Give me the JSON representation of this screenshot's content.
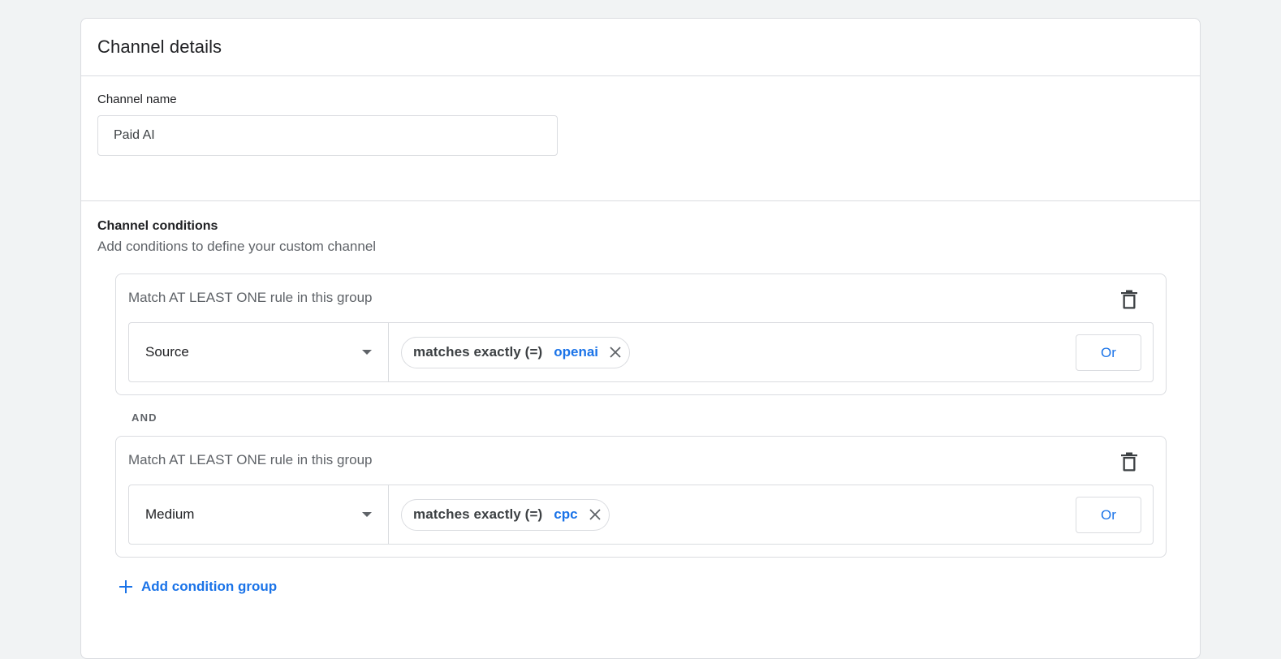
{
  "card": {
    "title": "Channel details"
  },
  "channel_name": {
    "label": "Channel name",
    "value": "Paid AI"
  },
  "conditions": {
    "title": "Channel conditions",
    "subtitle": "Add conditions to define your custom channel",
    "connector_label": "AND",
    "groups": [
      {
        "title": "Match AT LEAST ONE rule in this group",
        "dimension": "Source",
        "operator": "matches exactly (=)",
        "value": "openai",
        "or_label": "Or"
      },
      {
        "title": "Match AT LEAST ONE rule in this group",
        "dimension": "Medium",
        "operator": "matches exactly (=)",
        "value": "cpc",
        "or_label": "Or"
      }
    ],
    "add_group_label": "Add condition group"
  },
  "colors": {
    "accent": "#1a73e8",
    "border": "#dadce0",
    "background": "#f1f3f4"
  }
}
